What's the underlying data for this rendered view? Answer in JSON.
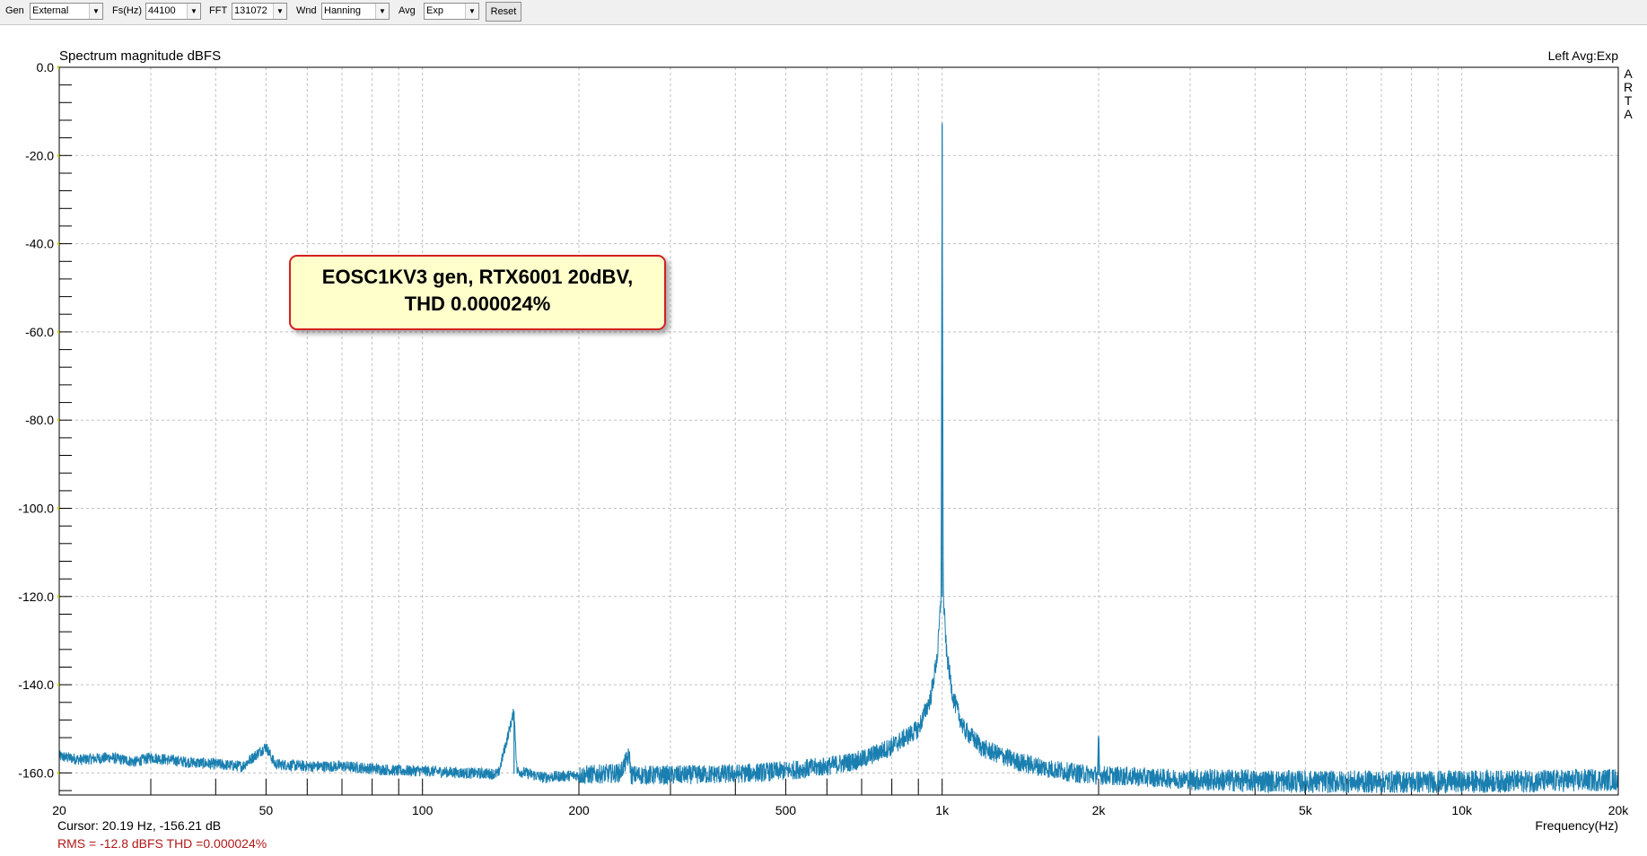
{
  "toolbar": {
    "gen_label": "Gen",
    "gen_value": "External",
    "fs_label": "Fs(Hz)",
    "fs_value": "44100",
    "fft_label": "FFT",
    "fft_value": "131072",
    "wnd_label": "Wnd",
    "wnd_value": "Hanning",
    "avg_label": "Avg",
    "avg_value": "Exp",
    "reset_label": "Reset"
  },
  "chart_data": {
    "type": "line",
    "title": "Spectrum magnitude dBFS",
    "channel_label": "Left  Avg:Exp",
    "side_label": [
      "A",
      "R",
      "T",
      "A"
    ],
    "xlabel": "Frequency(Hz)",
    "ylabel": "",
    "x_scale": "log",
    "xlim": [
      20,
      20000
    ],
    "ylim": [
      -165,
      0
    ],
    "x_ticks": [
      20,
      50,
      100,
      200,
      500,
      1000,
      2000,
      5000,
      10000,
      20000
    ],
    "x_tick_labels": [
      "20",
      "50",
      "100",
      "200",
      "500",
      "1k",
      "2k",
      "5k",
      "10k",
      "20k"
    ],
    "y_ticks": [
      0,
      -20,
      -40,
      -60,
      -80,
      -100,
      -120,
      -140,
      -160
    ],
    "y_tick_labels": [
      "0.0",
      "-20.0",
      "-40.0",
      "-60.0",
      "-80.0",
      "-100.0",
      "-120.0",
      "-140.0",
      "-160.0"
    ],
    "grid": true,
    "series": [
      {
        "name": "",
        "color": "#1a7fb0",
        "points": [
          [
            20,
            -156.2
          ],
          [
            22,
            -157
          ],
          [
            25,
            -156.5
          ],
          [
            28,
            -157.5
          ],
          [
            30,
            -156.5
          ],
          [
            35,
            -157.5
          ],
          [
            40,
            -158
          ],
          [
            45,
            -158.5
          ],
          [
            50,
            -154
          ],
          [
            52,
            -158
          ],
          [
            60,
            -158.5
          ],
          [
            70,
            -158.5
          ],
          [
            80,
            -159
          ],
          [
            90,
            -159.5
          ],
          [
            100,
            -159.5
          ],
          [
            120,
            -160
          ],
          [
            140,
            -160.2
          ],
          [
            150,
            -146
          ],
          [
            152,
            -159.5
          ],
          [
            170,
            -161
          ],
          [
            200,
            -160.5
          ],
          [
            240,
            -160
          ],
          [
            250,
            -156
          ],
          [
            252,
            -160.5
          ],
          [
            300,
            -160.5
          ],
          [
            400,
            -160.2
          ],
          [
            500,
            -159.5
          ],
          [
            600,
            -158.5
          ],
          [
            700,
            -157
          ],
          [
            800,
            -154
          ],
          [
            900,
            -150
          ],
          [
            950,
            -143
          ],
          [
            980,
            -133
          ],
          [
            995,
            -120
          ],
          [
            1000,
            -13
          ],
          [
            1005,
            -120
          ],
          [
            1020,
            -133
          ],
          [
            1050,
            -143
          ],
          [
            1100,
            -150
          ],
          [
            1200,
            -154.5
          ],
          [
            1400,
            -157.5
          ],
          [
            1600,
            -159
          ],
          [
            1800,
            -160
          ],
          [
            1990,
            -160.5
          ],
          [
            2000,
            -152
          ],
          [
            2010,
            -160.5
          ],
          [
            2500,
            -161
          ],
          [
            3000,
            -161.5
          ],
          [
            5000,
            -162
          ],
          [
            8000,
            -162
          ],
          [
            10000,
            -162
          ],
          [
            15000,
            -161.8
          ],
          [
            20000,
            -161.5
          ]
        ]
      }
    ]
  },
  "annotation": {
    "line1": "EOSC1KV3 gen, RTX6001 20dBV,",
    "line2": "THD 0.000024%"
  },
  "status": {
    "cursor": "Cursor: 20.19 Hz, -156.21 dB",
    "rms": "RMS =  -12.8 dBFS   THD =0.000024%"
  },
  "colors": {
    "trace": "#1a7fb0",
    "grid": "#c0c0c0",
    "rms_text": "#b01818",
    "annotation_border": "#d42020",
    "annotation_bg": "#ffffcc"
  }
}
